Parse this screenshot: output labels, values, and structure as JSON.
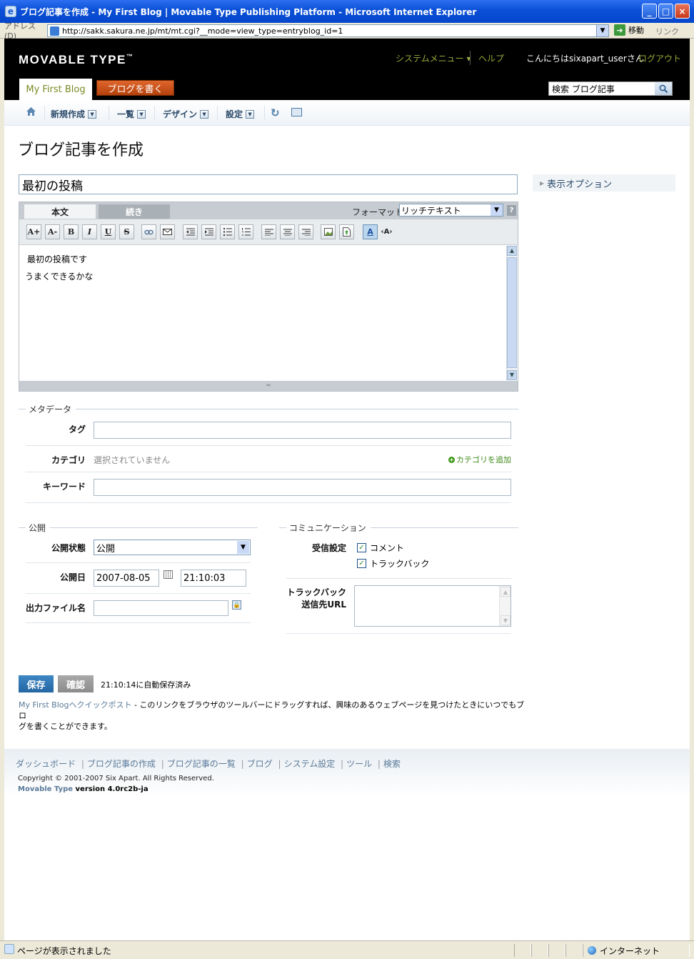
{
  "window": {
    "title": "ブログ記事を作成 - My First Blog | Movable Type Publishing Platform - Microsoft Internet Explorer",
    "buttons": [
      "_",
      "□",
      "×"
    ]
  },
  "address_bar": {
    "label": "アドレス(D)",
    "url": "http://sakk.sakura.ne.jp/mt/mt.cgi?__mode=view_type=entryblog_id=1",
    "go_label": "移動",
    "links_label": "リンク"
  },
  "header": {
    "logo": "MOVABLE TYPE",
    "logo_tm": "™",
    "system_menu": "システムメニュー ▾",
    "help": "ヘルプ",
    "greeting": "こんにちはsixapart_userさん",
    "logout": "ログアウト",
    "blog_tab": "My First Blog",
    "write_button": "ブログを書く",
    "search_placeholder": "検索 ブログ記事"
  },
  "nav": {
    "items": [
      {
        "label": "新規作成"
      },
      {
        "label": "一覧"
      },
      {
        "label": "デザイン"
      },
      {
        "label": "設定"
      }
    ]
  },
  "page": {
    "title": "ブログ記事を作成",
    "entry_title": "最初の投稿",
    "display_options": "表示オプション"
  },
  "editor": {
    "tab_body": "本文",
    "tab_extended": "続き",
    "format_label": "フォーマット:",
    "format_value": "リッチテキスト",
    "help": "?",
    "body_lines": [
      "最初の投稿です",
      "うまくできるかな"
    ],
    "toolbar": [
      "A+",
      "A-",
      "B",
      "I",
      "U",
      "S"
    ]
  },
  "metadata": {
    "heading": "メタデータ",
    "tags_label": "タグ",
    "tags_value": "",
    "category_label": "カテゴリ",
    "category_value": "選択されていません",
    "add_category": "カテゴリを追加",
    "keywords_label": "キーワード",
    "keywords_value": ""
  },
  "publish": {
    "heading": "公開",
    "status_label": "公開状態",
    "status_value": "公開",
    "date_label": "公開日",
    "date_value": "2007-08-05",
    "time_value": "21:10:03",
    "filename_label": "出力ファイル名",
    "filename_value": ""
  },
  "communication": {
    "heading": "コミュニケーション",
    "accept_label": "受信設定",
    "comments": "コメント",
    "trackbacks": "トラックバック",
    "tb_url_label_1": "トラックバック",
    "tb_url_label_2": "送信先URL"
  },
  "actions": {
    "save": "保存",
    "preview": "確認",
    "autosave": "21:10:14に自動保存済み",
    "quickpost_link": "My First Blogへクイックポスト",
    "quickpost_text_1": " - このリンクをブラウザのツールバーにドラッグすれば、興味のあるウェブページを見つけたときにいつでもブロ",
    "quickpost_text_2": "グを書くことができます。"
  },
  "footer": {
    "links": [
      "ダッシュボード",
      "ブログ記事の作成",
      "ブログ記事の一覧",
      "ブログ",
      "システム設定",
      "ツール",
      "検索"
    ],
    "copyright": "Copyright © 2001-2007 Six Apart. All Rights Reserved.",
    "product": "Movable Type",
    "version": " version 4.0rc2b-ja"
  },
  "status_bar": {
    "text": "ページが表示されました",
    "zone": "インターネット"
  },
  "colors": {
    "accent_green": "#7a8a24",
    "write_button": "#d2561c",
    "nav_text": "#2b4a6a",
    "link": "#5a7a99"
  }
}
